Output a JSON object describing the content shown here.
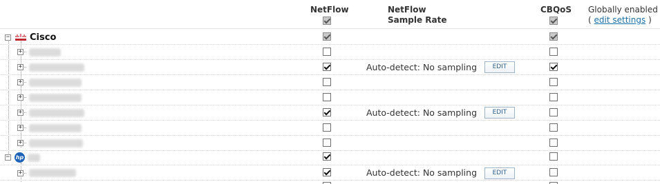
{
  "header": {
    "netflow_label": "NetFlow",
    "rate_label_line1": "NetFlow",
    "rate_label_line2": "Sample Rate",
    "cbqos_label": "CBQoS",
    "global_line1": "Globally enabled",
    "global_open": "(",
    "global_link": "edit settings",
    "global_close": ")"
  },
  "rate": {
    "text": "Auto-detect: No sampling",
    "edit_label": "EDIT"
  },
  "groups": [
    {
      "vendor": "Cisco",
      "icon": "cisco-logo-icon",
      "netflow": true,
      "netflow_disabled": true,
      "cbqos": true,
      "cbqos_disabled": true
    },
    {
      "vendor": "",
      "icon": "hp-logo-icon",
      "netflow": true,
      "cbqos": false
    }
  ],
  "nodes": [
    {
      "netflow": false,
      "cbqos": false,
      "has_rate": false
    },
    {
      "netflow": true,
      "cbqos": true,
      "has_rate": true
    },
    {
      "netflow": false,
      "cbqos": false,
      "has_rate": false
    },
    {
      "netflow": false,
      "cbqos": false,
      "has_rate": false
    },
    {
      "netflow": true,
      "cbqos": false,
      "has_rate": true
    },
    {
      "netflow": false,
      "cbqos": false,
      "has_rate": false
    },
    {
      "netflow": false,
      "cbqos": false,
      "has_rate": false
    },
    {
      "netflow": true,
      "cbqos": false,
      "has_rate": true
    }
  ]
}
